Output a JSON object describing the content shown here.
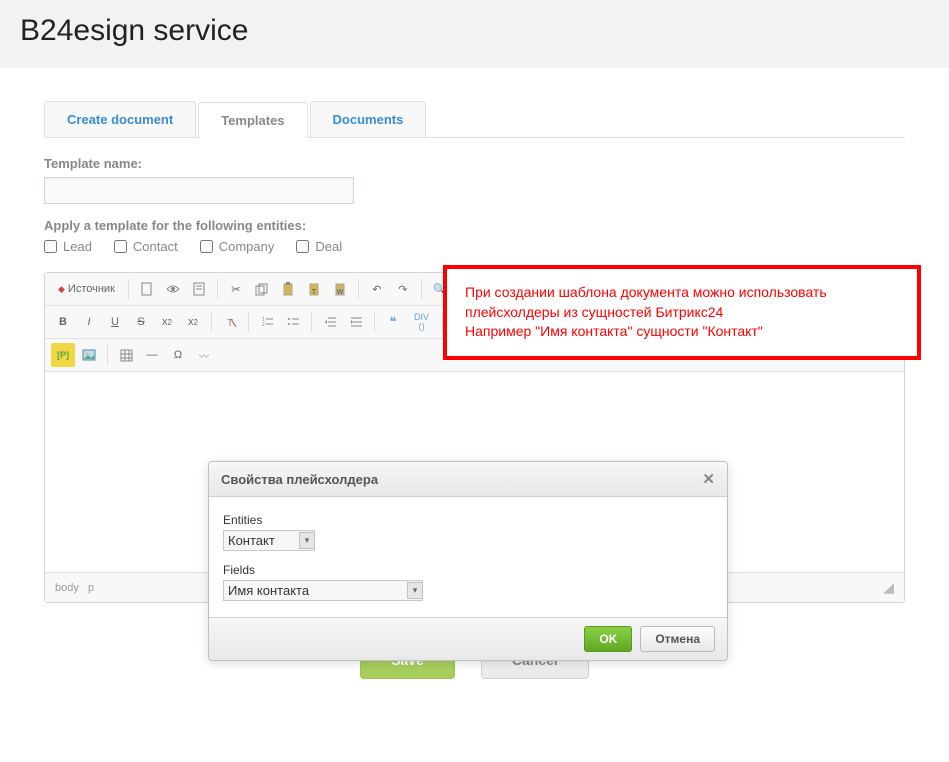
{
  "header": {
    "title": "B24esign service"
  },
  "tabs": [
    {
      "label": "Create document",
      "active": false
    },
    {
      "label": "Templates",
      "active": true
    },
    {
      "label": "Documents",
      "active": false
    }
  ],
  "form": {
    "template_name_label": "Template name:",
    "template_name_value": "",
    "apply_label": "Apply a template for the following entities:",
    "entities": [
      {
        "label": "Lead",
        "checked": false
      },
      {
        "label": "Contact",
        "checked": false
      },
      {
        "label": "Company",
        "checked": false
      },
      {
        "label": "Deal",
        "checked": false
      }
    ]
  },
  "callout": {
    "line1": "При создании шаблона документа можно использовать плейсхолдеры из сущностей Битрикс24",
    "line2": "Например \"Имя контакта\" сущности \"Контакт\""
  },
  "toolbar": {
    "source": "Источник"
  },
  "editor_status": {
    "path_body": "body",
    "path_p": "p"
  },
  "dialog": {
    "title": "Свойства плейсхолдера",
    "entities_label": "Entities",
    "entities_value": "Контакт",
    "fields_label": "Fields",
    "fields_value": "Имя контакта",
    "ok": "OK",
    "cancel": "Отмена"
  },
  "actions": {
    "save": "Save",
    "cancel": "Cancel"
  }
}
